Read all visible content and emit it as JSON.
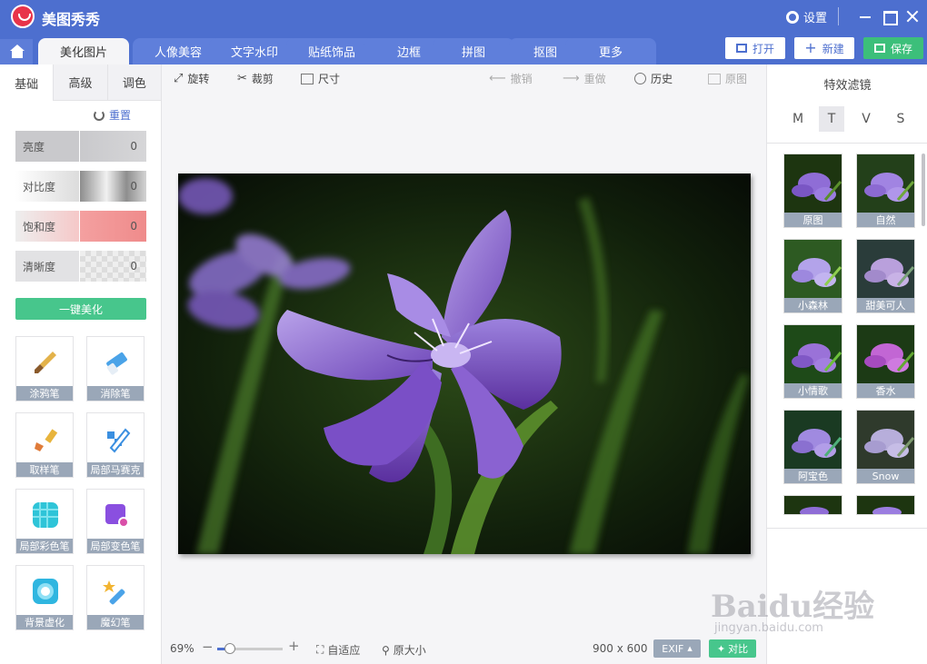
{
  "app": {
    "title": "美图秀秀",
    "settings_label": "设置"
  },
  "nav": {
    "tabs": [
      {
        "label": "美化图片",
        "active": true
      },
      {
        "label": "人像美容"
      },
      {
        "label": "文字水印"
      },
      {
        "label": "贴纸饰品"
      },
      {
        "label": "边框"
      },
      {
        "label": "拼图"
      },
      {
        "label": "抠图"
      },
      {
        "label": "更多"
      }
    ],
    "open_label": "打开",
    "new_label": "新建",
    "save_label": "保存"
  },
  "left": {
    "sub_tabs": [
      "基础",
      "高级",
      "调色"
    ],
    "reset_label": "重置",
    "sliders": [
      {
        "label": "亮度",
        "value": "0"
      },
      {
        "label": "对比度",
        "value": "0"
      },
      {
        "label": "饱和度",
        "value": "0"
      },
      {
        "label": "清晰度",
        "value": "0"
      }
    ],
    "auto_label": "一键美化",
    "tools": [
      "涂鸦笔",
      "消除笔",
      "取样笔",
      "局部马赛克",
      "局部彩色笔",
      "局部变色笔",
      "背景虚化",
      "魔幻笔"
    ]
  },
  "toolbar": {
    "rotate": "旋转",
    "crop": "裁剪",
    "size": "尺寸",
    "undo": "撤销",
    "redo": "重做",
    "history": "历史",
    "original": "原图"
  },
  "status": {
    "zoom": "69%",
    "zoom_level": 0.2,
    "fit": "自适应",
    "actual": "原大小",
    "dimensions": "900 x 600",
    "exif": "EXIF",
    "compare": "对比"
  },
  "right": {
    "title": "特效滤镜",
    "categories": [
      "M",
      "T",
      "V",
      "S"
    ],
    "active_category": "T",
    "filters": [
      "原图",
      "自然",
      "小森林",
      "甜美可人",
      "小情歌",
      "香水",
      "阿宝色",
      "Snow"
    ]
  },
  "watermark": {
    "text": "Baidu经验",
    "sub": "jingyan.baidu.com"
  },
  "colors": {
    "brand": "#4d6fcf",
    "accent_green": "#47c68c",
    "label_gray": "#9aa7b8"
  }
}
